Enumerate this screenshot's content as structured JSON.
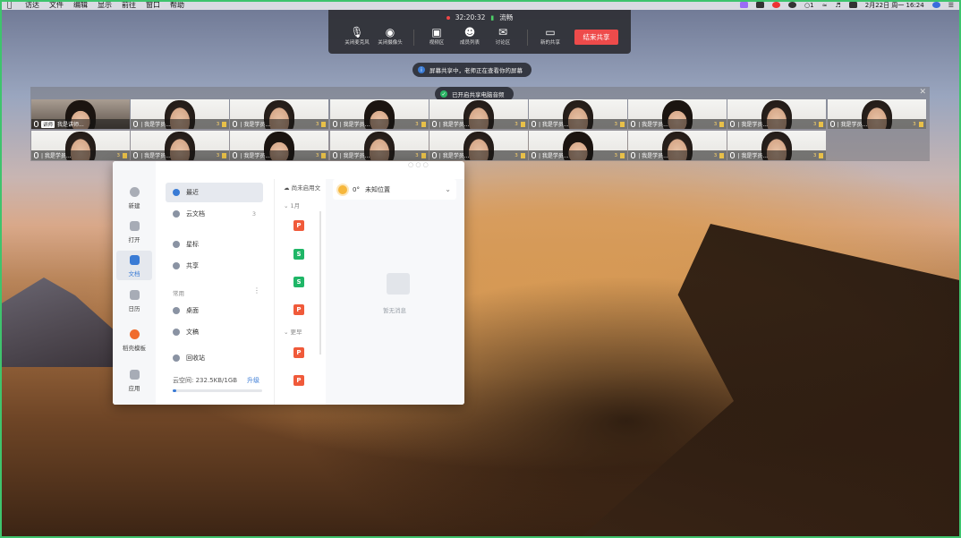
{
  "menubar": {
    "items": [
      "访达",
      "文件",
      "编辑",
      "显示",
      "前往",
      "窗口",
      "帮助"
    ],
    "status_icons": [
      "app-icon",
      "monitor-icon",
      "record-icon",
      "focus-icon",
      "messages-icon",
      "wifi-icon",
      "volume-icon",
      "keyboard-icon",
      "siri-icon",
      "control-center-icon"
    ],
    "messages_count": "1",
    "datetime": "2月22日 周一 16:24"
  },
  "toolbar": {
    "timer": "32:20:32",
    "network": "流畅",
    "buttons": [
      {
        "label": "关闭麦克风",
        "icon": "microphone-icon"
      },
      {
        "label": "关闭摄像头",
        "icon": "camera-icon"
      },
      {
        "label": "视频区",
        "icon": "video-area-icon"
      },
      {
        "label": "成员列表",
        "icon": "members-icon"
      },
      {
        "label": "讨论区",
        "icon": "chat-icon"
      },
      {
        "label": "新的共享",
        "icon": "share-screen-icon"
      }
    ],
    "end_share": "结束共享"
  },
  "notices": {
    "sharing": "屏幕共享中，老师正在查看你的屏幕",
    "audio": "已开启共享电脑音频"
  },
  "video_strip": {
    "row1": [
      {
        "name": "我是讲师...",
        "tag": "讲师",
        "count": ""
      },
      {
        "name": "我是学员...",
        "tag": "",
        "count": "3"
      },
      {
        "name": "我是学员...",
        "tag": "",
        "count": "3"
      },
      {
        "name": "我是学员...",
        "tag": "",
        "count": "3"
      },
      {
        "name": "我是学员...",
        "tag": "",
        "count": "3"
      },
      {
        "name": "我是学员...",
        "tag": "",
        "count": "3"
      },
      {
        "name": "我是学员...",
        "tag": "",
        "count": "3"
      },
      {
        "name": "我是学员...",
        "tag": "",
        "count": "3"
      },
      {
        "name": "我是学员...",
        "tag": "",
        "count": "3"
      }
    ],
    "row2": [
      {
        "name": "我是学员...",
        "count": "3"
      },
      {
        "name": "我是学员...",
        "count": "3"
      },
      {
        "name": "我是学员...",
        "count": "3"
      },
      {
        "name": "我是学员...",
        "count": "3"
      },
      {
        "name": "我是学员...",
        "count": "3"
      },
      {
        "name": "我是学员...",
        "count": "3"
      },
      {
        "name": "我是学员...",
        "count": "3"
      },
      {
        "name": "我是学员...",
        "count": "3"
      }
    ]
  },
  "docs": {
    "rail": [
      {
        "label": "新建",
        "icon": "plus-icon"
      },
      {
        "label": "打开",
        "icon": "folder-icon"
      },
      {
        "label": "文档",
        "icon": "document-icon"
      },
      {
        "label": "日历",
        "icon": "calendar-icon"
      },
      {
        "label": "稻壳模板",
        "icon": "template-icon"
      },
      {
        "label": "应用",
        "icon": "apps-icon"
      }
    ],
    "nav": {
      "recent": "最近",
      "cloud": "云文档",
      "cloud_count": "3",
      "star": "星标",
      "share": "共享",
      "common_group": "常用",
      "desktop": "桌面",
      "docs_folder": "文稿",
      "trash": "回收站",
      "storage": "云空间: 232.5KB/1GB",
      "upgrade": "升级"
    },
    "storage_used_fraction": 0.0002,
    "filelist": {
      "header": "尚未启用文",
      "group_month": "1月",
      "group_earlier": "更早",
      "icons": [
        "P",
        "S",
        "S",
        "P",
        "P",
        "P"
      ]
    },
    "weather": {
      "temp": "0°",
      "location": "未知位置"
    },
    "empty_text": "暂无消息"
  }
}
